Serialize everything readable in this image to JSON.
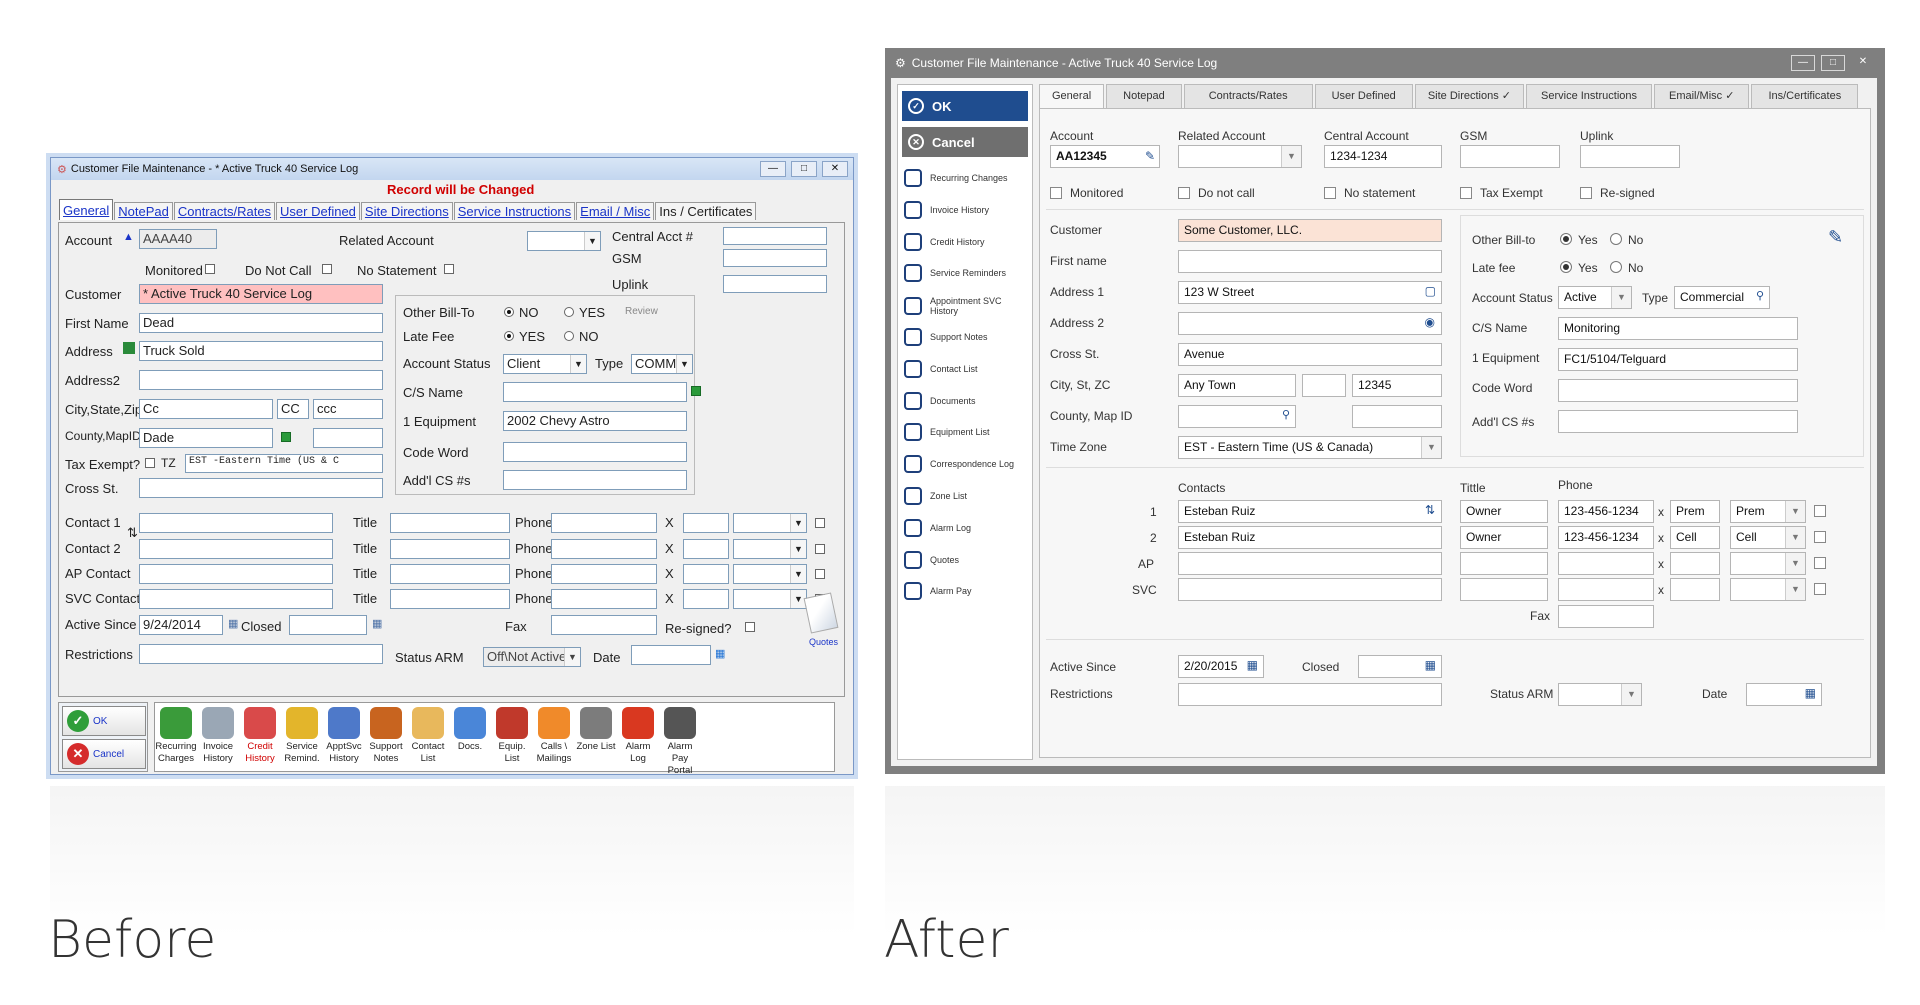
{
  "captions": {
    "before": "Before",
    "after": "After"
  },
  "old": {
    "title": "Customer File Maintenance - * Active Truck 40 Service Log",
    "warning": "Record will be Changed",
    "tabs": [
      "General",
      "NotePad",
      "Contracts/Rates",
      "User Defined",
      "Site Directions",
      "Service Instructions",
      "Email / Misc",
      "Ins / Certificates"
    ],
    "labels": {
      "account": "Account",
      "related_account": "Related Account",
      "central_acct": "Central Acct #",
      "gsm": "GSM",
      "uplink": "Uplink",
      "monitored": "Monitored",
      "do_not_call": "Do Not Call",
      "no_statement": "No Statement",
      "customer": "Customer",
      "first_name": "First Name",
      "address": "Address",
      "address2": "Address2",
      "city_state_zip": "City,State,Zip",
      "county_mapid": "County,MapID",
      "tax_exempt": "Tax Exempt?",
      "tz": "TZ",
      "cross_st": "Cross St.",
      "other_bill_to": "Other Bill-To",
      "late_fee": "Late Fee",
      "no": "NO",
      "yes": "YES",
      "review": "Review",
      "account_status": "Account Status",
      "type": "Type",
      "cs_name": "C/S Name",
      "equipment": "1 Equipment",
      "code_word": "Code Word",
      "addl_cs": "Add'l CS #s",
      "contact1": "Contact 1",
      "contact2": "Contact 2",
      "ap_contact": "AP Contact",
      "svc_contact": "SVC Contact",
      "title": "Title",
      "phone": "Phone",
      "x": "X",
      "active_since": "Active Since",
      "closed": "Closed",
      "fax": "Fax",
      "resigned": "Re-signed?",
      "restrictions": "Restrictions",
      "status_arm": "Status ARM",
      "date": "Date",
      "quotes": "Quotes"
    },
    "values": {
      "account": "AAAA40",
      "customer": "* Active Truck 40 Service Log",
      "first_name": "Dead",
      "address": "Truck Sold",
      "city": "Cc",
      "state": "CC",
      "zip": "ccc",
      "county": "Dade",
      "timezone": "EST -Eastern Time (US & C",
      "account_status": "Client",
      "type": "COMM",
      "equipment": "2002 Chevy Astro",
      "active_since": "9/24/2014",
      "status_arm": "Off\\Not Active"
    },
    "buttons": {
      "ok": "OK",
      "cancel": "Cancel"
    },
    "toolbar": [
      {
        "label": "Recurring Charges",
        "color": "#3a9b3a",
        "red": false
      },
      {
        "label": "Invoice History",
        "color": "#9aa7b5",
        "red": false
      },
      {
        "label": "Credit History",
        "color": "#d94a4a",
        "red": true
      },
      {
        "label": "Service Remind.",
        "color": "#e3b52b",
        "red": false
      },
      {
        "label": "ApptSvc History",
        "color": "#4e79c9",
        "red": false
      },
      {
        "label": "Support Notes",
        "color": "#c8641f",
        "red": false
      },
      {
        "label": "Contact List",
        "color": "#e8b85c",
        "red": false
      },
      {
        "label": "Docs.",
        "color": "#4a86d8",
        "red": false
      },
      {
        "label": "Equip. List",
        "color": "#c0392b",
        "red": false
      },
      {
        "label": "Calls \\ Mailings",
        "color": "#f08a2a",
        "red": false
      },
      {
        "label": "Zone List",
        "color": "#7c7c7c",
        "red": false
      },
      {
        "label": "Alarm Log",
        "color": "#d93820",
        "red": false
      },
      {
        "label": "Alarm Pay Portal",
        "color": "#555555",
        "red": false
      }
    ]
  },
  "new": {
    "title": "Customer File Maintenance - Active Truck 40 Service Log",
    "ok": "OK",
    "cancel": "Cancel",
    "side_items": [
      "Recurring Changes",
      "Invoice History",
      "Credit History",
      "Service Reminders",
      "Appointment SVC History",
      "Support Notes",
      "Contact List",
      "Documents",
      "Equipment List",
      "Correspondence Log",
      "Zone List",
      "Alarm Log",
      "Quotes",
      "Alarm Pay"
    ],
    "tabs": [
      "General",
      "Notepad",
      "Contracts/Rates",
      "User Defined",
      "Site Directions",
      "Service Instructions",
      "Email/Misc",
      "Ins/Certificates"
    ],
    "labels": {
      "account": "Account",
      "related_account": "Related Account",
      "central_account": "Central Account",
      "gsm": "GSM",
      "uplink": "Uplink",
      "monitored": "Monitored",
      "do_not_call": "Do not call",
      "no_statement": "No statement",
      "tax_exempt": "Tax Exempt",
      "resigned": "Re-signed",
      "customer": "Customer",
      "first_name": "First name",
      "address1": "Address 1",
      "address2": "Address 2",
      "cross_st": "Cross St.",
      "city_st_zc": "City, St, ZC",
      "county_map": "County, Map ID",
      "time_zone": "Time Zone",
      "other_bill_to": "Other Bill-to",
      "late_fee": "Late fee",
      "yes": "Yes",
      "no": "No",
      "account_status": "Account Status",
      "type": "Type",
      "cs_name": "C/S Name",
      "equipment": "1 Equipment",
      "code_word": "Code Word",
      "addl_cs": "Add'l CS #s",
      "contacts": "Contacts",
      "title": "Tittle",
      "phone": "Phone",
      "row1": "1",
      "row2": "2",
      "ap": "AP",
      "svc": "SVC",
      "x": "x",
      "fax": "Fax",
      "active_since": "Active Since",
      "closed": "Closed",
      "restrictions": "Restrictions",
      "status_arm": "Status ARM",
      "date": "Date"
    },
    "values": {
      "account": "AA12345",
      "central_account": "1234-1234",
      "customer": "Some Customer, LLC.",
      "address1": "123 W Street",
      "cross_st": "Avenue",
      "city": "Any Town",
      "zip": "12345",
      "time_zone": "EST - Eastern Time (US & Canada)",
      "account_status": "Active",
      "type": "Commercial",
      "cs_name": "Monitoring",
      "equipment": "FC1/5104/Telguard",
      "contact1": "Esteban Ruiz",
      "title1": "Owner",
      "phone1": "123-456-1234",
      "ext1": "Prem",
      "ptype1": "Prem",
      "contact2": "Esteban Ruiz",
      "title2": "Owner",
      "phone2": "123-456-1234",
      "ext2": "Cell",
      "ptype2": "Cell",
      "active_since": "2/20/2015"
    }
  }
}
